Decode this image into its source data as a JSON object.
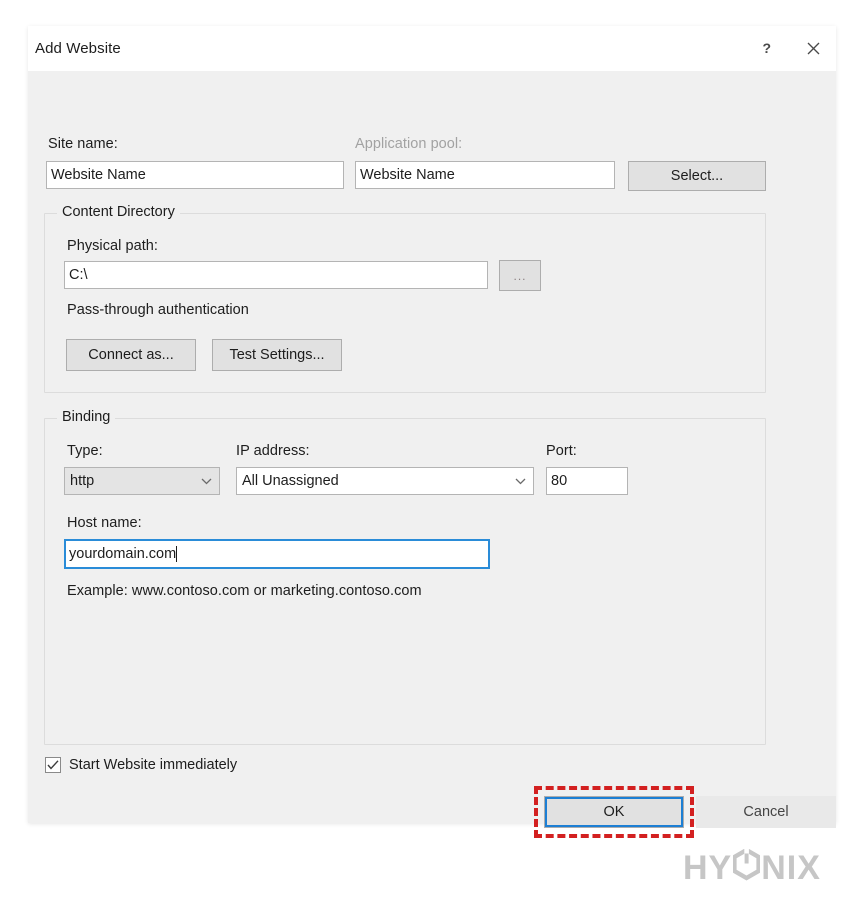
{
  "window": {
    "title": "Add Website",
    "help_icon": "question-mark-icon",
    "close_icon": "close-x-icon"
  },
  "site_name": {
    "label": "Site name:",
    "value": "Website Name"
  },
  "application_pool": {
    "label": "Application pool:",
    "value": "Website Name",
    "disabled": true,
    "select_button": "Select..."
  },
  "content_directory": {
    "title": "Content Directory",
    "physical_path_label": "Physical path:",
    "physical_path_value": "C:\\",
    "browse_button": "...",
    "auth_text": "Pass-through authentication",
    "connect_as_button": "Connect as...",
    "test_settings_button": "Test Settings..."
  },
  "binding": {
    "title": "Binding",
    "type_label": "Type:",
    "type_value": "http",
    "ip_label": "IP address:",
    "ip_value": "All Unassigned",
    "port_label": "Port:",
    "port_value": "80",
    "host_label": "Host name:",
    "host_value": "yourdomain.com",
    "example_text": "Example: www.contoso.com or marketing.contoso.com"
  },
  "start_website": {
    "label": "Start Website immediately",
    "checked": true
  },
  "footer": {
    "ok_button": "OK",
    "cancel_button": "Cancel"
  },
  "annotation": {
    "highlight_color": "#d32020",
    "target": "ok-button"
  },
  "branding": {
    "logo_text_left": "HY",
    "logo_text_right": "NIX",
    "logo_full": "HYONIX",
    "logo_color": "#c6c6c6"
  }
}
